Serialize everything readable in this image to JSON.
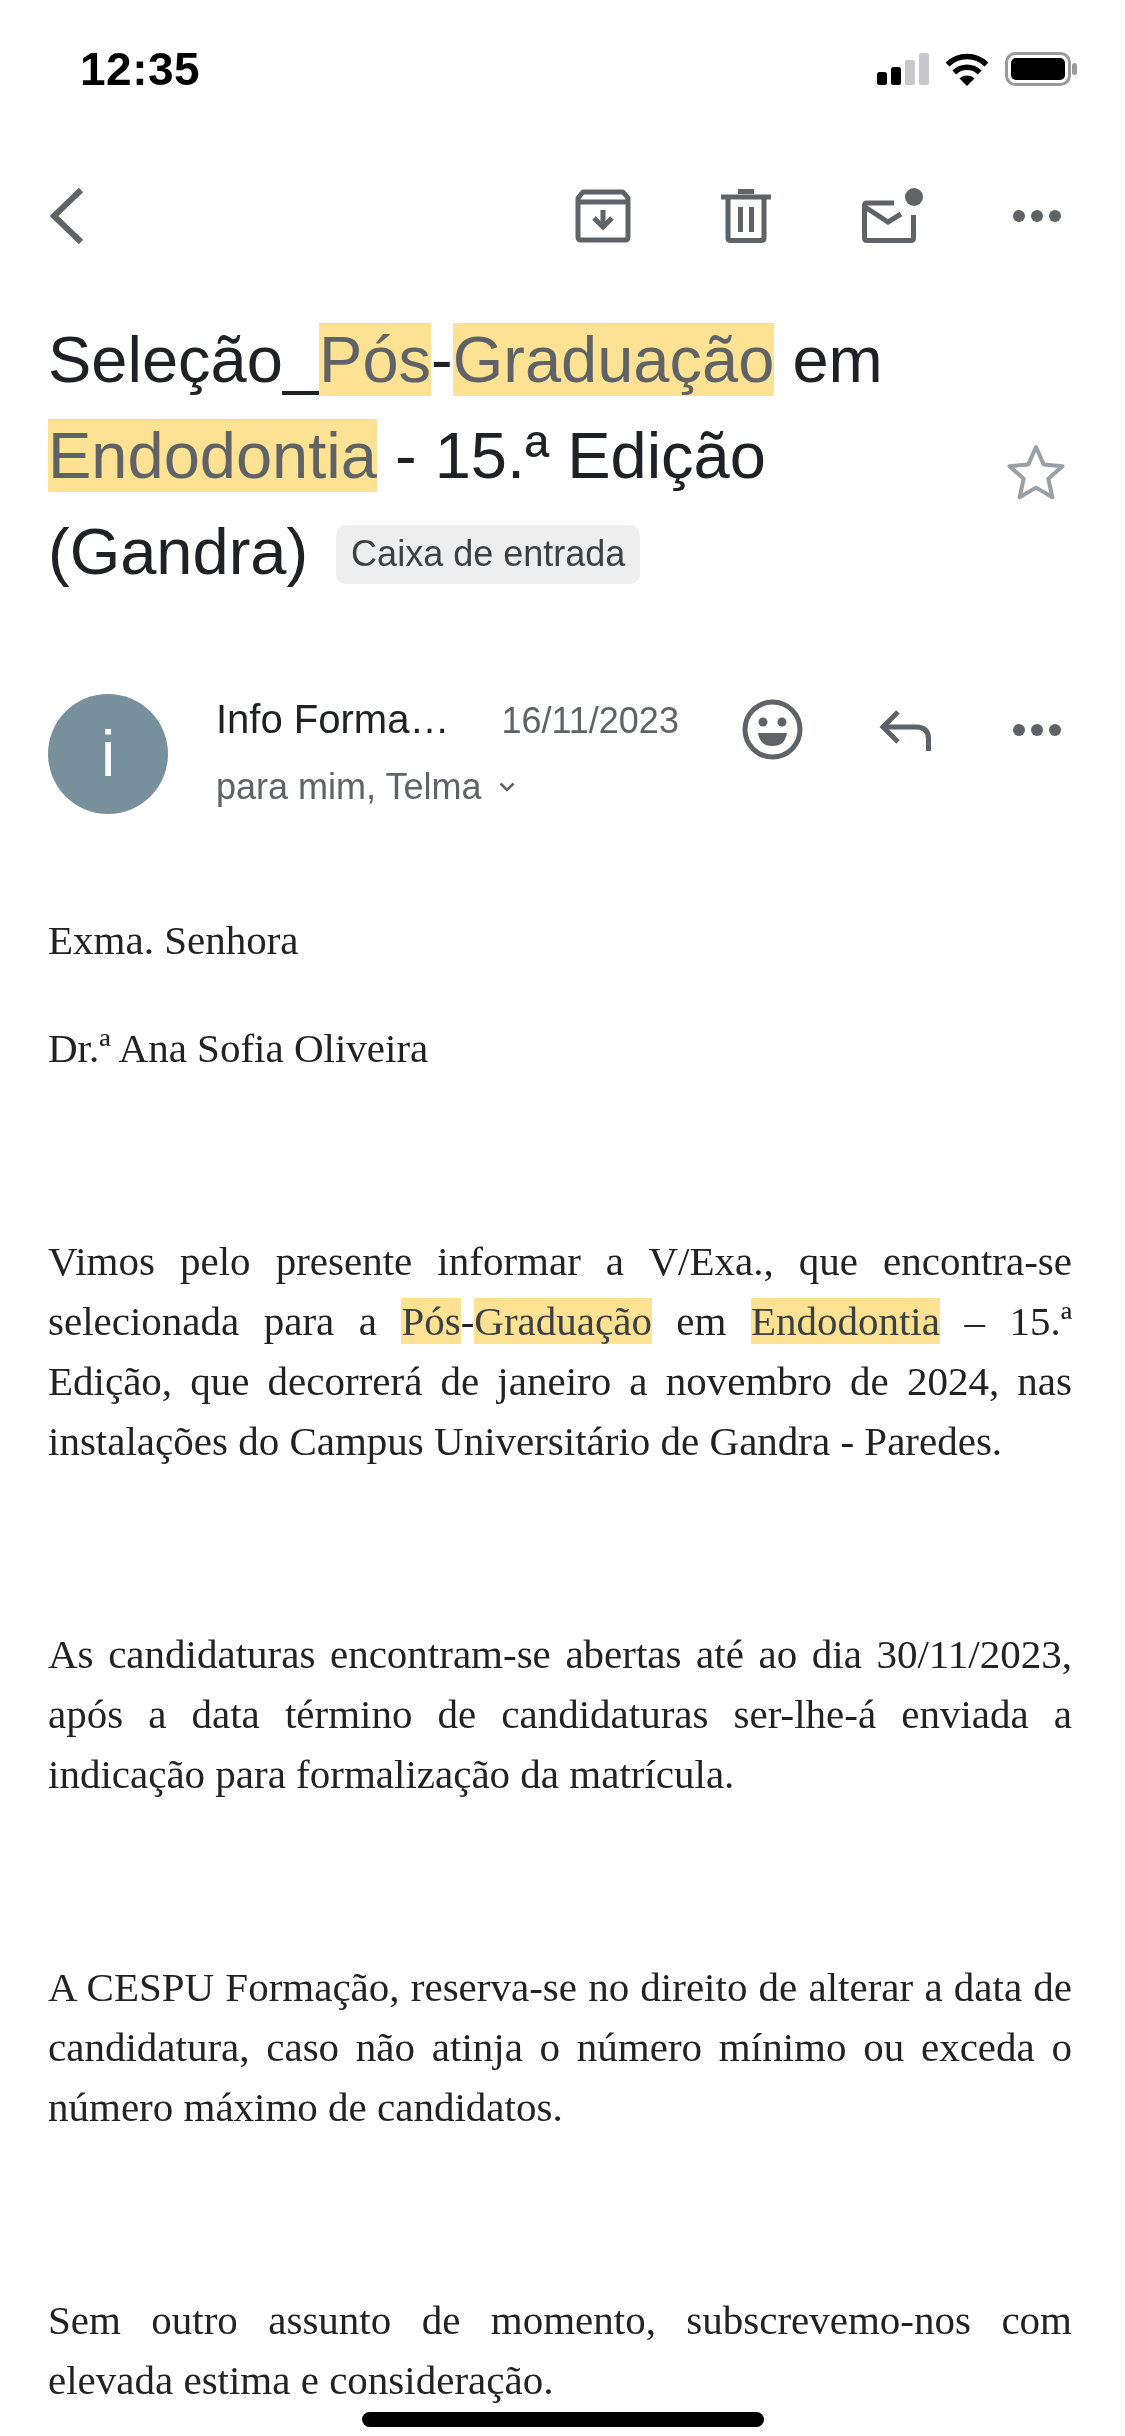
{
  "status_bar": {
    "time": "12:35"
  },
  "message_header": {
    "subject": {
      "segments": [
        {
          "text": "Seleção_",
          "highlighted": false
        },
        {
          "text": "Pós",
          "highlighted": true
        },
        {
          "text": "-",
          "highlighted": false
        },
        {
          "text": "Graduação",
          "highlighted": true
        },
        {
          "text": " em ",
          "highlighted": false
        },
        {
          "text": "Endodontia",
          "highlighted": true
        },
        {
          "text": " - 15.ª Edição (Gandra)",
          "highlighted": false
        }
      ]
    },
    "label": "Caixa de entrada",
    "starred": false
  },
  "sender": {
    "avatar_letter": "i",
    "name": "Info Forma…",
    "date": "16/11/2023",
    "recipients": "para mim, Telma"
  },
  "body": {
    "greeting": [
      "Exma. Senhora",
      "Dr.ª Ana Sofia Oliveira"
    ],
    "paragraphs": [
      {
        "segments": [
          {
            "text": "Vimos pelo presente informar a V/Exa., que encontra-se selecionada para a ",
            "highlighted": false
          },
          {
            "text": "Pós",
            "highlighted": true
          },
          {
            "text": "-",
            "highlighted": false
          },
          {
            "text": "Graduação",
            "highlighted": true
          },
          {
            "text": " em ",
            "highlighted": false
          },
          {
            "text": "Endodontia",
            "highlighted": true
          },
          {
            "text": " – 15.ª Edição, que decorrerá de janeiro a novembro de 2024, nas instalações do Campus Universitário de Gandra - Paredes.",
            "highlighted": false
          }
        ]
      },
      {
        "segments": [
          {
            "text": "As candidaturas encontram-se abertas até ao dia 30/11/2023, após a data término de candidaturas ser-lhe-á enviada a indicação para formalização da matrícula.",
            "highlighted": false
          }
        ]
      },
      {
        "segments": [
          {
            "text": "A CESPU Formação, reserva-se no direito de alterar a data de candidatura, caso não atinja o número mínimo ou exceda o número máximo de candidatos.",
            "highlighted": false
          }
        ]
      },
      {
        "segments": [
          {
            "text": "Sem outro assunto de momento, subscrevemo-nos com elevada estima e consideração.",
            "highlighted": false
          }
        ]
      }
    ]
  }
}
